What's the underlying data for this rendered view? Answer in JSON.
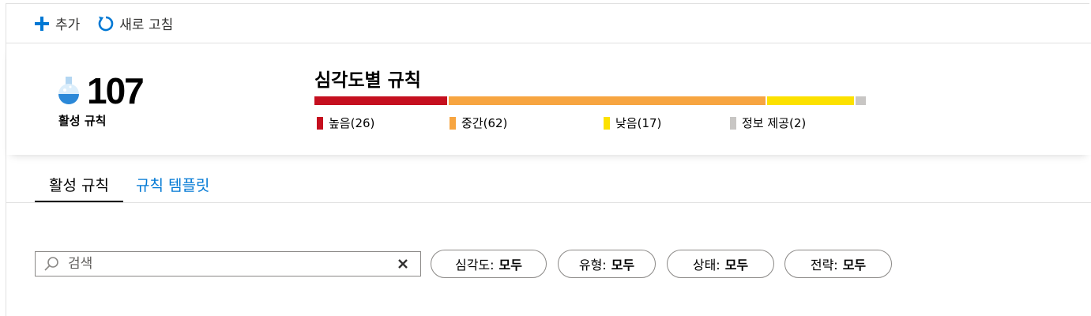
{
  "toolbar": {
    "add_label": "추가",
    "refresh_label": "새로 고침"
  },
  "summary": {
    "active_count": "107",
    "active_label": "활성 규칙",
    "severity_title": "심각도별 규칙",
    "severity": [
      {
        "label": "높음(26)",
        "count": 26,
        "color": "#c50f1f"
      },
      {
        "label": "중간(62)",
        "count": 62,
        "color": "#f7a541"
      },
      {
        "label": "낮음(17)",
        "count": 17,
        "color": "#fce100"
      },
      {
        "label": "정보 제공(2)",
        "count": 2,
        "color": "#c8c6c4"
      }
    ]
  },
  "tabs": [
    {
      "label": "활성 규칙",
      "active": true
    },
    {
      "label": "규칙 템플릿",
      "active": false
    }
  ],
  "search": {
    "placeholder": "검색"
  },
  "filters": [
    {
      "key": "심각도:",
      "value": "모두"
    },
    {
      "key": "유형:",
      "value": "모두"
    },
    {
      "key": "상태:",
      "value": "모두"
    },
    {
      "key": "전략:",
      "value": "모두"
    }
  ],
  "colors": {
    "accent": "#0078d4",
    "text": "#323130",
    "border": "#8a8886"
  }
}
